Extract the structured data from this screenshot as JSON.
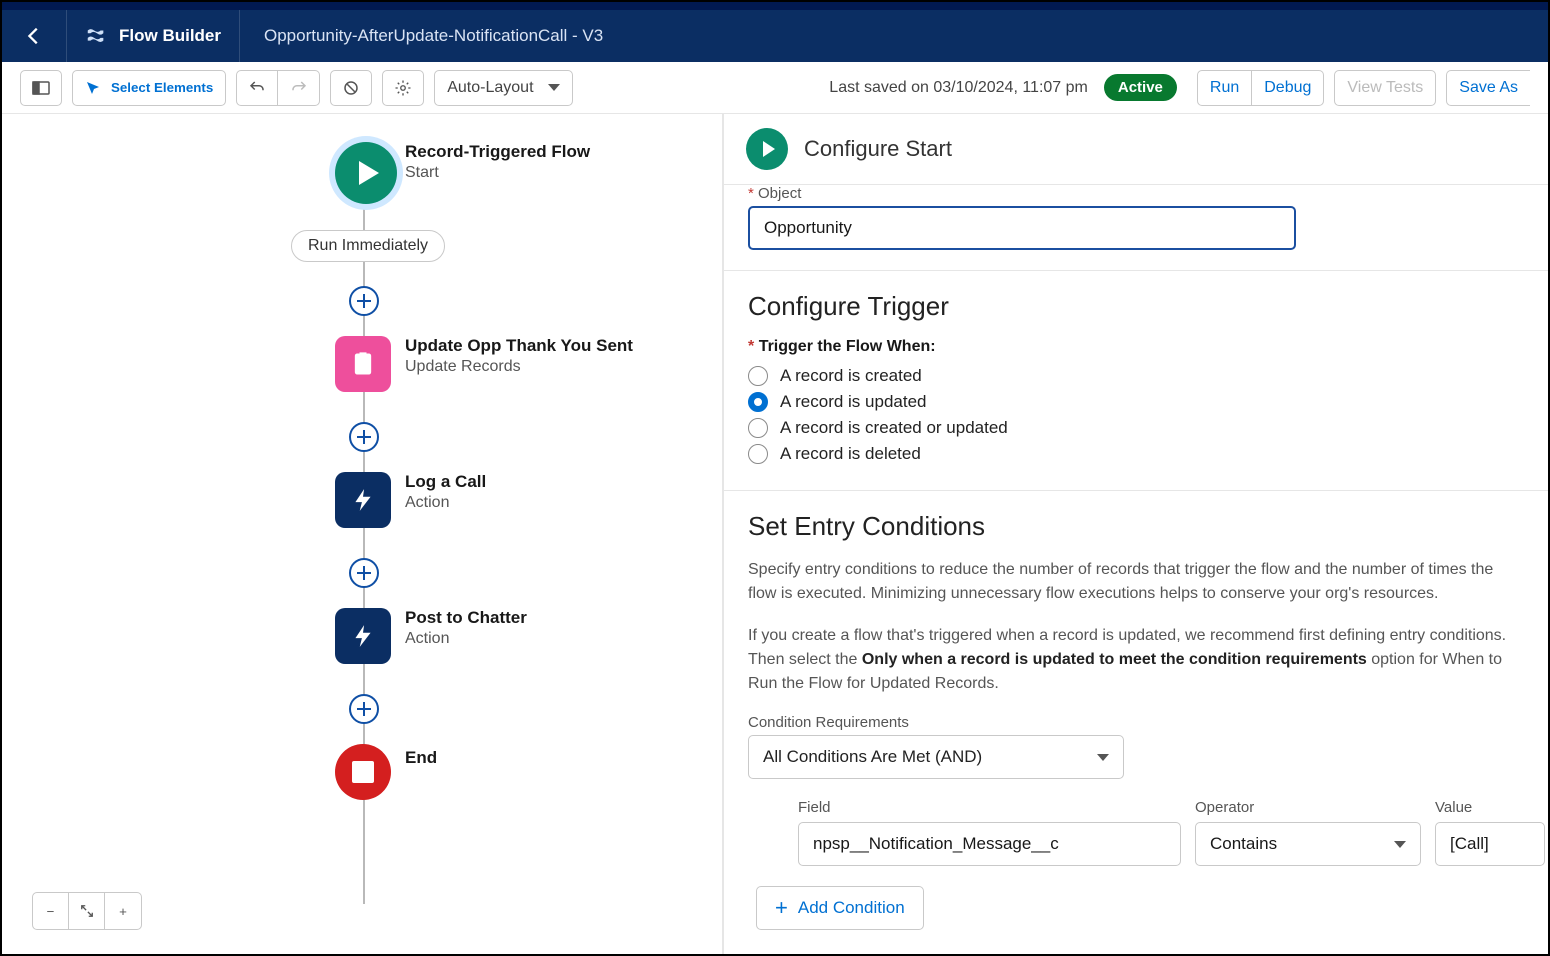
{
  "header": {
    "app": "Flow Builder",
    "title": "Opportunity-AfterUpdate-NotificationCall - V3"
  },
  "toolbar": {
    "select_elements": "Select Elements",
    "auto_layout": "Auto-Layout",
    "last_saved": "Last saved on 03/10/2024, 11:07 pm",
    "status": "Active",
    "run": "Run",
    "debug": "Debug",
    "view_tests": "View Tests",
    "save_as": "Save As"
  },
  "canvas": {
    "start": {
      "title": "Record-Triggered Flow",
      "sub": "Start"
    },
    "badge": "Run Immediately",
    "n1": {
      "title": "Update Opp Thank You Sent",
      "sub": "Update Records"
    },
    "n2": {
      "title": "Log a Call",
      "sub": "Action"
    },
    "n3": {
      "title": "Post to Chatter",
      "sub": "Action"
    },
    "end": "End"
  },
  "panel": {
    "title": "Configure Start",
    "object_label": "Object",
    "object_value": "Opportunity",
    "trigger_heading": "Configure Trigger",
    "trigger_when": "Trigger the Flow When:",
    "trigger_options": {
      "created": "A record is created",
      "updated": "A record is updated",
      "created_or_updated": "A record is created or updated",
      "deleted": "A record is deleted"
    },
    "entry_heading": "Set Entry Conditions",
    "entry_desc1": "Specify entry conditions to reduce the number of records that trigger the flow and the number of times the flow is executed. Minimizing unnecessary flow executions helps to conserve your org's resources.",
    "entry_desc2a": "If you create a flow that's triggered when a record is updated, we recommend first defining entry conditions. Then select the ",
    "entry_desc2b": "Only when a record is updated to meet the condition requirements",
    "entry_desc2c": " option for When to Run the Flow for Updated Records.",
    "cond_req_label": "Condition Requirements",
    "cond_req_value": "All Conditions Are Met (AND)",
    "cond": {
      "field_label": "Field",
      "field_value": "npsp__Notification_Message__c",
      "operator_label": "Operator",
      "operator_value": "Contains",
      "value_label": "Value",
      "value_value": "[Call]"
    },
    "add_condition": "Add Condition"
  }
}
